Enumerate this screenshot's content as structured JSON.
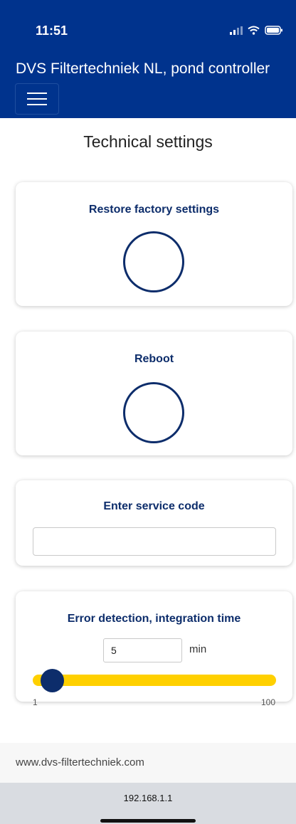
{
  "status_bar": {
    "time": "11:51"
  },
  "header": {
    "title": "DVS Filtertechniek NL, pond controller"
  },
  "icons": {
    "menu": "hamburger-menu-icon",
    "signal": "signal-icon",
    "wifi": "wifi-icon",
    "battery": "battery-icon"
  },
  "page": {
    "title": "Technical settings"
  },
  "cards": {
    "restore": {
      "title": "Restore factory settings"
    },
    "reboot": {
      "title": "Reboot"
    },
    "service_code": {
      "title": "Enter service code",
      "value": ""
    },
    "error_detection": {
      "title": "Error detection, integration time",
      "value": "5",
      "unit": "min",
      "min": "1",
      "max": "100",
      "slider_value": 5
    }
  },
  "footer": {
    "text": "www.dvs-filtertechniek.com"
  },
  "browser": {
    "url": "192.168.1.1"
  },
  "colors": {
    "header_bg": "#00338d",
    "accent_dark": "#0d2d6b",
    "slider": "#ffd000"
  }
}
